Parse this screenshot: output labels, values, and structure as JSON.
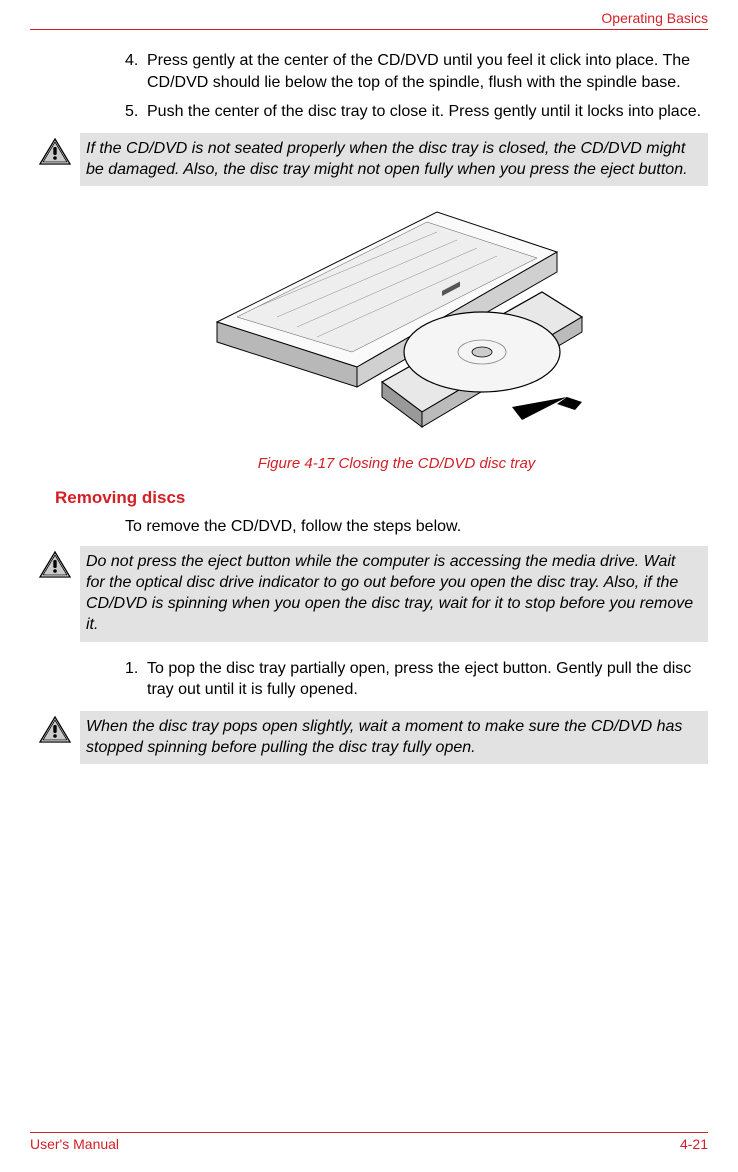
{
  "header": {
    "title": "Operating Basics"
  },
  "steps_a": [
    {
      "num": "4.",
      "text": "Press gently at the center of the CD/DVD until you feel it click into place. The CD/DVD should lie below the top of the spindle, flush with the spindle base."
    },
    {
      "num": "5.",
      "text": "Push the center of the disc tray to close it. Press gently until it locks into place."
    }
  ],
  "caution1": "If the CD/DVD is not seated properly when the disc tray is closed, the CD/DVD might be damaged. Also, the disc tray might not open fully when you press the eject button.",
  "figure_caption": "Figure 4-17 Closing the CD/DVD disc tray",
  "section_heading": "Removing discs",
  "intro_text": "To remove the CD/DVD, follow the steps below.",
  "caution2": "Do not press the eject button while the computer is accessing the media drive. Wait for the optical disc drive indicator to go out before you open the disc tray. Also, if the CD/DVD is spinning when you open the disc tray, wait for it to stop before you remove it.",
  "steps_b": [
    {
      "num": "1.",
      "text": "To pop the disc tray partially open, press the eject button. Gently pull the disc tray out until it is fully opened."
    }
  ],
  "caution3": "When the disc tray pops open slightly, wait a moment to make sure the CD/DVD has stopped spinning before pulling the disc tray fully open.",
  "footer": {
    "left": "User's Manual",
    "right": "4-21"
  }
}
